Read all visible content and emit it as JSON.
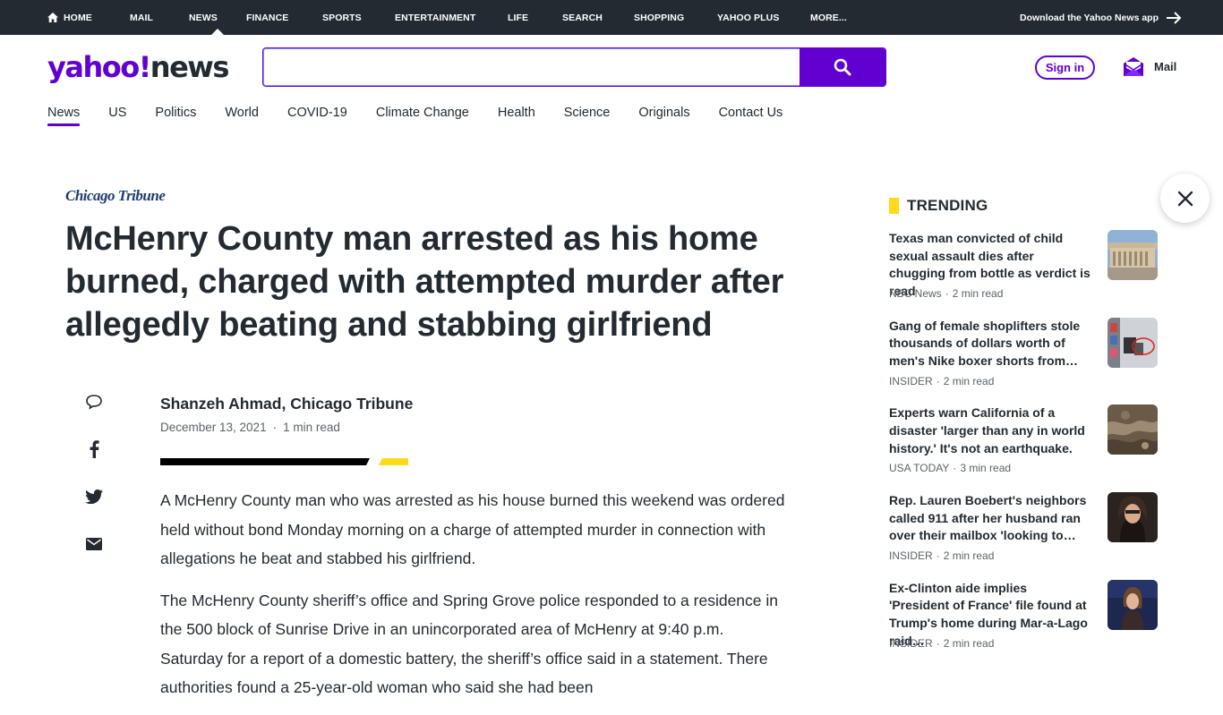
{
  "topnav": {
    "items": [
      {
        "label": "HOME",
        "icon": "home-icon",
        "active": false
      },
      {
        "label": "MAIL",
        "active": false
      },
      {
        "label": "NEWS",
        "active": true
      },
      {
        "label": "FINANCE",
        "active": false
      },
      {
        "label": "SPORTS",
        "active": false
      },
      {
        "label": "ENTERTAINMENT",
        "active": false
      },
      {
        "label": "LIFE",
        "active": false
      },
      {
        "label": "SEARCH",
        "active": false
      },
      {
        "label": "SHOPPING",
        "active": false
      },
      {
        "label": "YAHOO PLUS",
        "active": false
      },
      {
        "label": "MORE...",
        "active": false
      }
    ],
    "download_app": "Download the Yahoo News app",
    "download_icon": "arrow-right-icon"
  },
  "header": {
    "logo_brand": "yahoo!",
    "logo_product": "news",
    "search_placeholder": "",
    "search_value": "",
    "search_icon": "search-icon",
    "signin_label": "Sign in",
    "mail_label": "Mail",
    "mail_icon": "envelope-icon"
  },
  "subnav": {
    "items": [
      {
        "label": "News",
        "active": true
      },
      {
        "label": "US"
      },
      {
        "label": "Politics"
      },
      {
        "label": "World"
      },
      {
        "label": "COVID-19"
      },
      {
        "label": "Climate Change"
      },
      {
        "label": "Health"
      },
      {
        "label": "Science"
      },
      {
        "label": "Originals"
      },
      {
        "label": "Contact Us"
      }
    ]
  },
  "article": {
    "provider": "Chicago Tribune",
    "headline": "McHenry County man arrested as his home burned, charged with attempted murder after allegedly beating and stabbing girlfriend",
    "author": "Shanzeh Ahmad, Chicago Tribune",
    "date": "December 13, 2021",
    "read_time": "1 min read",
    "share_icons": [
      "comment-icon",
      "facebook-icon",
      "twitter-icon",
      "email-icon"
    ],
    "paragraphs": [
      "A McHenry County man who was arrested as his house burned this weekend was ordered held without bond Monday morning on a charge of attempted murder in connection with allegations he beat and stabbed his girlfriend.",
      "The McHenry County sheriff’s office and Spring Grove police responded to a residence in the 500 block of Sunrise Drive in an unincorporated area of McHenry at 9:40 p.m. Saturday for a report of a domestic battery, the sheriff’s office said in a statement. There authorities found a 25-year-old woman who said she had been"
    ]
  },
  "trending": {
    "title": "TRENDING",
    "accent_color": "#ffd91a",
    "items": [
      {
        "title": "Texas man convicted of child sexual assault dies after chugging from bottle as verdict is read",
        "source": "NBC News",
        "read_time": "2 min read"
      },
      {
        "title": "Gang of female shoplifters stole thousands of dollars worth of men's Nike boxer shorts from…",
        "source": "INSIDER",
        "read_time": "2 min read"
      },
      {
        "title": "Experts warn California of a disaster 'larger than any in world history.' It's not an earthquake.",
        "source": "USA TODAY",
        "read_time": "3 min read"
      },
      {
        "title": "Rep. Lauren Boebert's neighbors called 911 after her husband ran over their mailbox 'looking to…",
        "source": "INSIDER",
        "read_time": "2 min read"
      },
      {
        "title": "Ex-Clinton aide implies 'President of France' file found at Trump's home during Mar-a-Lago raid…",
        "source": "INSIDER",
        "read_time": "2 min read"
      }
    ]
  },
  "close_icon": "close-icon",
  "colors": {
    "brand": "#6001d2",
    "topbar": "#232a31",
    "text": "#232a31",
    "muted": "#5b636a"
  }
}
